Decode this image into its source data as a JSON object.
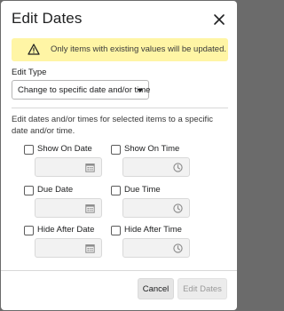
{
  "dialog": {
    "title": "Edit Dates",
    "close_icon": "close-icon",
    "alert": {
      "icon": "warning-icon",
      "text": "Only items with existing values will be updated.",
      "background": "#fff5a5"
    },
    "edit_type": {
      "label": "Edit Type",
      "selected": "Change to specific date and/or time"
    },
    "description": "Edit dates and/or times for selected items to a specific date and/or time.",
    "fields": {
      "show_on_date": {
        "label": "Show On Date",
        "checked": false,
        "icon": "calendar-icon"
      },
      "show_on_time": {
        "label": "Show On Time",
        "checked": false,
        "icon": "clock-icon"
      },
      "due_date": {
        "label": "Due Date",
        "checked": false,
        "icon": "calendar-icon"
      },
      "due_time": {
        "label": "Due Time",
        "checked": false,
        "icon": "clock-icon"
      },
      "hide_after_date": {
        "label": "Hide After Date",
        "checked": false,
        "icon": "calendar-icon"
      },
      "hide_after_time": {
        "label": "Hide After Time",
        "checked": false,
        "icon": "clock-icon"
      }
    },
    "buttons": {
      "cancel": "Cancel",
      "edit_dates": "Edit Dates"
    }
  }
}
